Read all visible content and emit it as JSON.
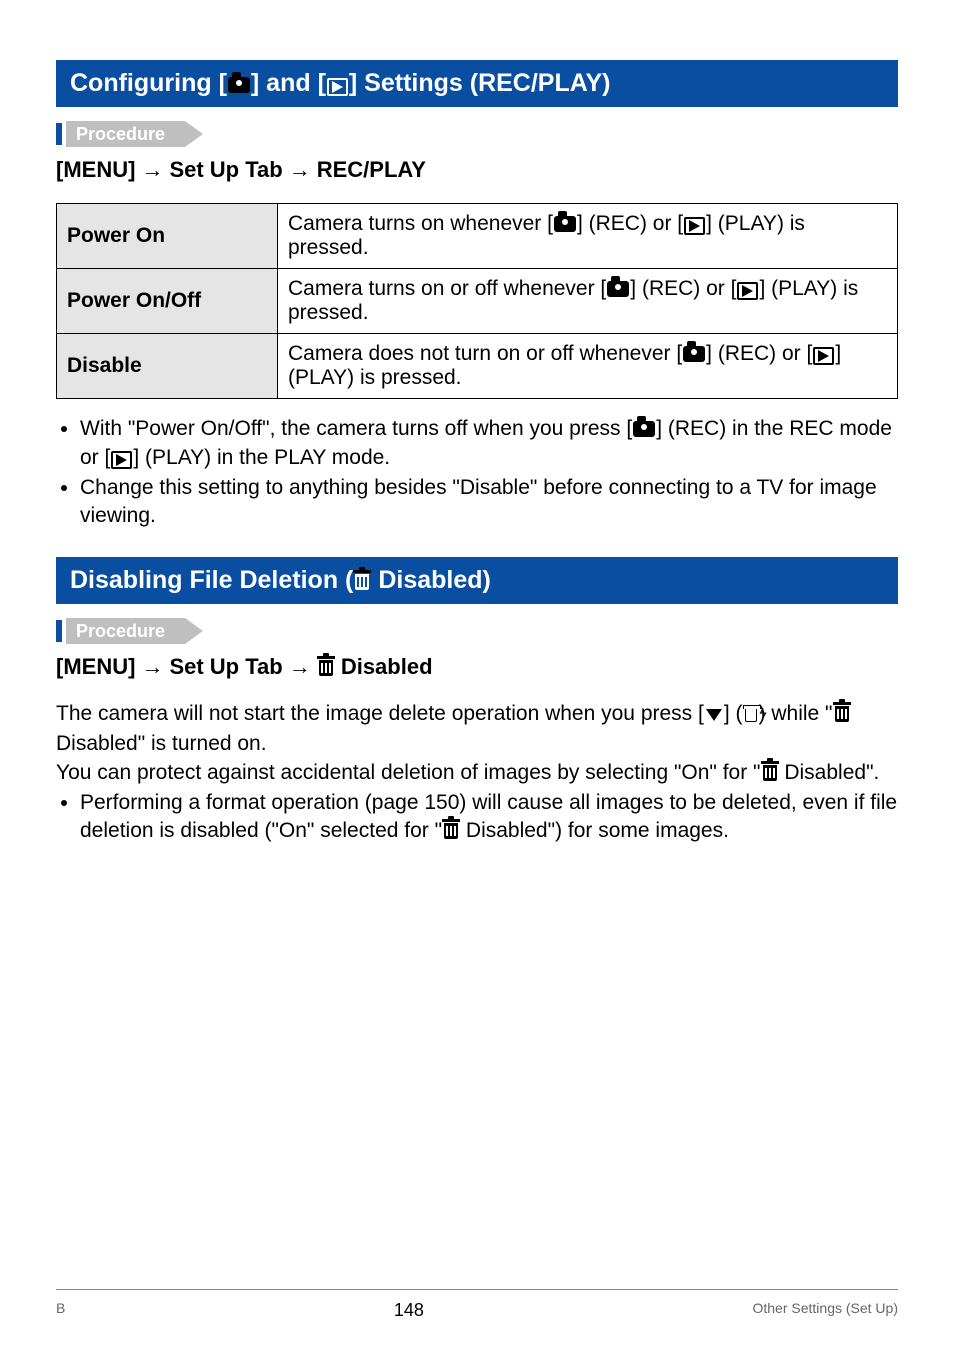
{
  "section1": {
    "title_pre": "Configuring [",
    "title_mid": "] and [",
    "title_post": "] Settings (REC/PLAY)",
    "procedure_label": "Procedure",
    "path_pre": "[MENU]",
    "path_mid": "Set Up Tab",
    "path_end": "REC/PLAY",
    "rows": [
      {
        "head": "Power On",
        "pre": "Camera turns on whenever [",
        "mid": "] (REC) or [",
        "post": "] (PLAY) is pressed."
      },
      {
        "head": "Power On/Off",
        "pre": "Camera turns on or off whenever [",
        "mid": "] (REC) or [",
        "post": "] (PLAY) is pressed."
      },
      {
        "head": "Disable",
        "pre": "Camera does not turn on or off whenever [",
        "mid": "] (REC) or [",
        "post": "] (PLAY) is pressed."
      }
    ],
    "bullet1_pre": "With \"Power On/Off\", the camera turns off when you press [",
    "bullet1_mid": "] (REC) in the REC mode or [",
    "bullet1_post": "] (PLAY) in the PLAY mode.",
    "bullet2": "Change this setting to anything besides \"Disable\" before connecting to a TV for image viewing."
  },
  "section2": {
    "title_pre": "Disabling File Deletion (",
    "title_post": " Disabled)",
    "procedure_label": "Procedure",
    "path_pre": "[MENU]",
    "path_mid": "Set Up Tab",
    "path_end": " Disabled",
    "para1_pre": "The camera will not start the image delete operation when you press [",
    "para1_mid": "] (",
    "para1_post": ") while \"",
    "para1_end": " Disabled\" is turned on.",
    "para2_pre": "You can protect against accidental deletion of images by selecting \"On\" for \"",
    "para2_post": " Disabled\".",
    "bullet_pre": "Performing a format operation (page 150) will cause all images to be deleted, even if file deletion is disabled (\"On\" selected for \"",
    "bullet_post": " Disabled\") for some images."
  },
  "footer": {
    "left": "B",
    "page": "148",
    "right": "Other Settings (Set Up)"
  }
}
